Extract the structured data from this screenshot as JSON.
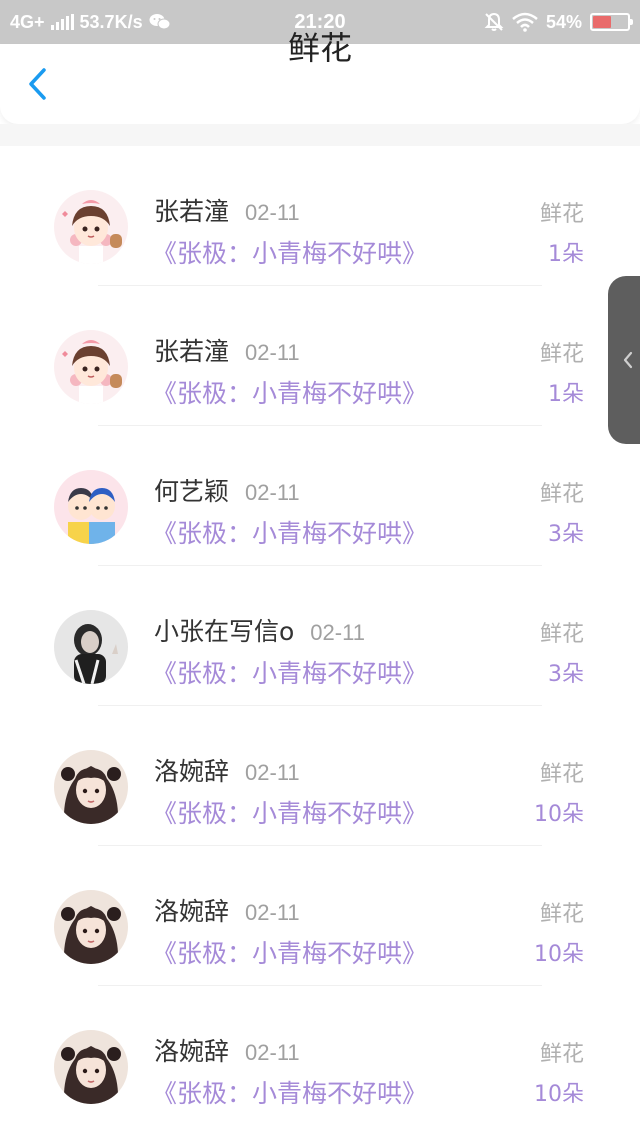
{
  "status_bar": {
    "network": "4G+",
    "speed": "53.7K/s",
    "time": "21:20",
    "battery": "54%",
    "battery_level": 0.54,
    "icons": [
      "signal-bars-icon",
      "wechat-icon",
      "bell-off-icon",
      "wifi-icon",
      "battery-icon"
    ]
  },
  "header": {
    "title": "鲜花",
    "back_icon": "chevron-left-icon"
  },
  "colors": {
    "accent_purple": "#a58ad8",
    "back_blue": "#1a9bf0",
    "status_bar_bg": "#c8c8c8"
  },
  "list": [
    {
      "name": "张若潼",
      "date": "02-11",
      "book": "《张极：小青梅不好哄》",
      "gift_label": "鲜花",
      "count": "1朵",
      "avatar": "girl-cartoon-avatar"
    },
    {
      "name": "张若潼",
      "date": "02-11",
      "book": "《张极：小青梅不好哄》",
      "gift_label": "鲜花",
      "count": "1朵",
      "avatar": "girl-cartoon-avatar"
    },
    {
      "name": "何艺颖",
      "date": "02-11",
      "book": "《张极：小青梅不好哄》",
      "gift_label": "鲜花",
      "count": "3朵",
      "avatar": "couple-cartoon-avatar"
    },
    {
      "name": "小张在写信o",
      "date": "02-11",
      "book": "《张极：小青梅不好哄》",
      "gift_label": "鲜花",
      "count": "3朵",
      "avatar": "photo-avatar"
    },
    {
      "name": "洛婉辞",
      "date": "02-11",
      "book": "《张极：小青梅不好哄》",
      "gift_label": "鲜花",
      "count": "10朵",
      "avatar": "girl-photo-avatar"
    },
    {
      "name": "洛婉辞",
      "date": "02-11",
      "book": "《张极：小青梅不好哄》",
      "gift_label": "鲜花",
      "count": "10朵",
      "avatar": "girl-photo-avatar"
    },
    {
      "name": "洛婉辞",
      "date": "02-11",
      "book": "《张极：小青梅不好哄》",
      "gift_label": "鲜花",
      "count": "10朵",
      "avatar": "girl-photo-avatar"
    }
  ],
  "side_tab": {
    "icon": "chevron-left-icon"
  }
}
